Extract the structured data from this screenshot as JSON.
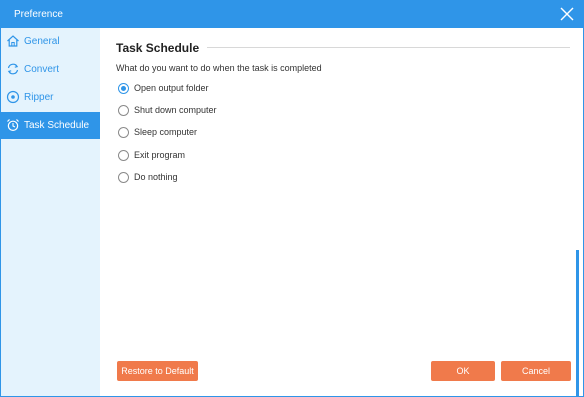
{
  "window": {
    "title": "Preference"
  },
  "sidebar": {
    "items": [
      {
        "label": "General",
        "icon": "home-icon",
        "active": false
      },
      {
        "label": "Convert",
        "icon": "refresh-icon",
        "active": false
      },
      {
        "label": "Ripper",
        "icon": "disc-icon",
        "active": false
      },
      {
        "label": "Task Schedule",
        "icon": "alarm-clock-icon",
        "active": true
      }
    ]
  },
  "main": {
    "section_title": "Task Schedule",
    "question": "What do you want to do when the task is completed",
    "options": [
      {
        "label": "Open output folder",
        "checked": true
      },
      {
        "label": "Shut down computer",
        "checked": false
      },
      {
        "label": "Sleep computer",
        "checked": false
      },
      {
        "label": "Exit program",
        "checked": false
      },
      {
        "label": "Do nothing",
        "checked": false
      }
    ]
  },
  "footer": {
    "restore_label": "Restore to Default",
    "ok_label": "OK",
    "cancel_label": "Cancel"
  },
  "colors": {
    "accent": "#2f95e8",
    "sidebar_bg": "#e4f3fd",
    "button": "#f07a4b"
  }
}
